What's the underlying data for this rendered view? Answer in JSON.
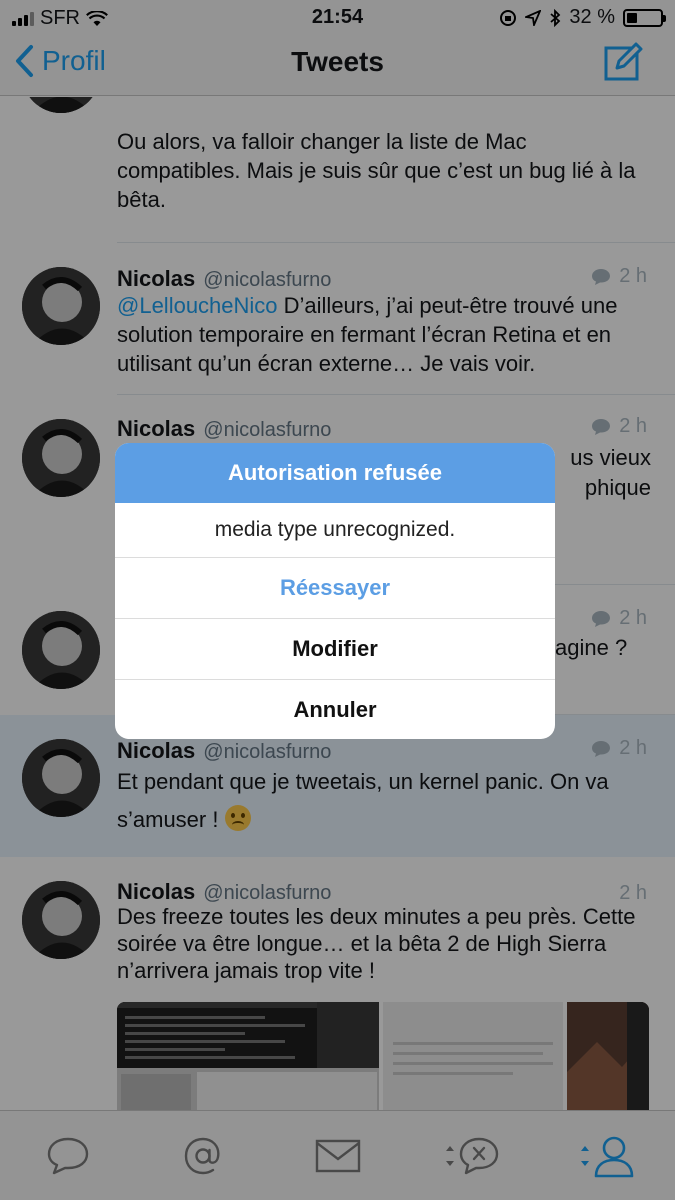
{
  "status_bar": {
    "carrier": "SFR",
    "time": "21:54",
    "battery": "32 %",
    "battery_level": 0.32
  },
  "nav": {
    "back_label": "Profil",
    "title": "Tweets",
    "compose_icon": "compose-icon"
  },
  "tweets": [
    {
      "text": "Ou alors, va falloir changer la liste de Mac compatibles. Mais je suis sûr que c’est un bug lié à la bêta."
    },
    {
      "name": "Nicolas",
      "handle": "@nicolasfurno",
      "time": "2 h",
      "mention": "@LelloucheNico",
      "text": " D’ailleurs, j’ai peut-être trouvé une solution temporaire en fermant l’écran Retina et en utilisant qu’un écran externe… Je vais voir."
    },
    {
      "name": "Nicolas",
      "handle": "@nicolasfurno",
      "time": "2 h",
      "visible_fragments": [
        "us vieux",
        "phique"
      ]
    },
    {
      "time": "2 h",
      "visible_fragment": "agine ?"
    },
    {
      "name": "Nicolas",
      "handle": "@nicolasfurno",
      "time": "2 h",
      "text": "Et pendant que je tweetais, un kernel panic. On va s’amuser ! ",
      "emoji": "crying-face"
    },
    {
      "name": "Nicolas",
      "handle": "@nicolasfurno",
      "time": "2 h",
      "text": "Des freeze toutes les deux minutes a peu près. Cette soirée va être longue… et la bêta 2 de High Sierra n’arrivera jamais trop vite !"
    }
  ],
  "tab_bar": {
    "tabs": [
      "chat-bubble-icon",
      "at-icon",
      "envelope-icon",
      "sort-bubble-icon",
      "person-icon"
    ]
  },
  "alert": {
    "title": "Autorisation refusée",
    "message": "media type unrecognized.",
    "actions": [
      "Réessayer",
      "Modifier",
      "Annuler"
    ]
  },
  "colors": {
    "accent": "#1da1f2",
    "alert_header": "#5c9ee4",
    "highlight_row": "#e8f3fd"
  }
}
